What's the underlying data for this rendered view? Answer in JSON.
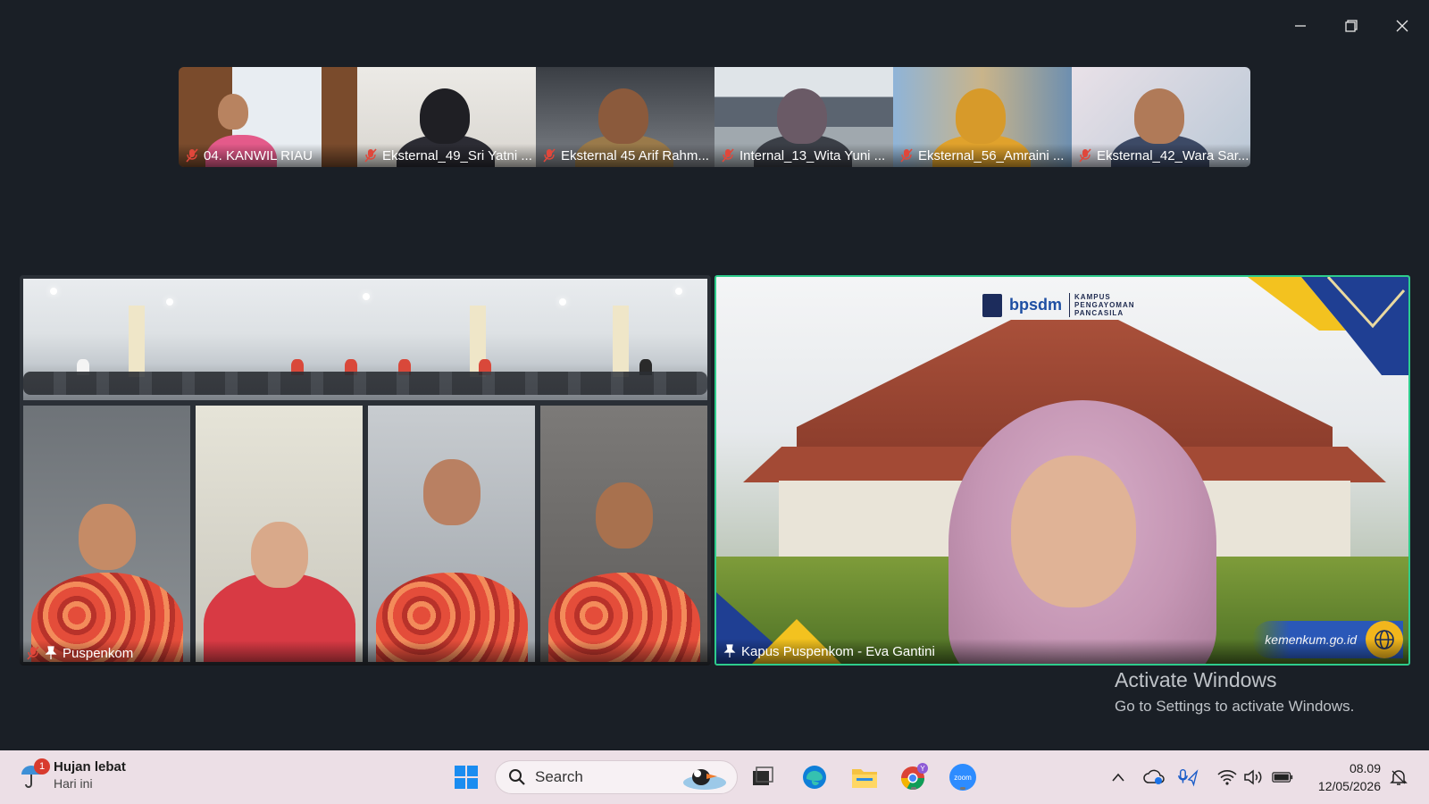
{
  "window": {
    "minimize_label": "Minimize",
    "restore_label": "Restore",
    "close_label": "Close"
  },
  "filmstrip": [
    {
      "name": "04. KANWIL RIAU",
      "muted": true
    },
    {
      "name": "Eksternal_49_Sri Yatni ...",
      "muted": true
    },
    {
      "name": "Eksternal 45 Arif Rahm...",
      "muted": true
    },
    {
      "name": "Internal_13_Wita Yuni ...",
      "muted": true
    },
    {
      "name": "Eksternal_56_Amraini ...",
      "muted": true
    },
    {
      "name": "Eksternal_42_Wara Sar...",
      "muted": true
    }
  ],
  "gallery": {
    "left_tile_name": "Puspenkom",
    "speaker_name": "Kapus Puspenkom - Eva Gantini"
  },
  "background": {
    "logo_brand": "bpsdm",
    "logo_line1": "KAMPUS",
    "logo_line2": "PENGAYOMAN",
    "logo_line3": "PANCASILA",
    "url": "kemenkum.go.id"
  },
  "activation": {
    "title": "Activate Windows",
    "subtitle": "Go to Settings to activate Windows."
  },
  "taskbar": {
    "weather_title": "Hujan lebat",
    "weather_sub": "Hari ini",
    "weather_badge": "1",
    "search_placeholder": "Search",
    "chrome_badge": "Y",
    "zoom_label": "zoom",
    "time": "08.09",
    "date": "12/05/2026"
  },
  "colors": {
    "active_speaker_border": "#2ecc8c",
    "taskbar_bg": "#ecdfe6",
    "app_bg": "#1a1f26"
  }
}
